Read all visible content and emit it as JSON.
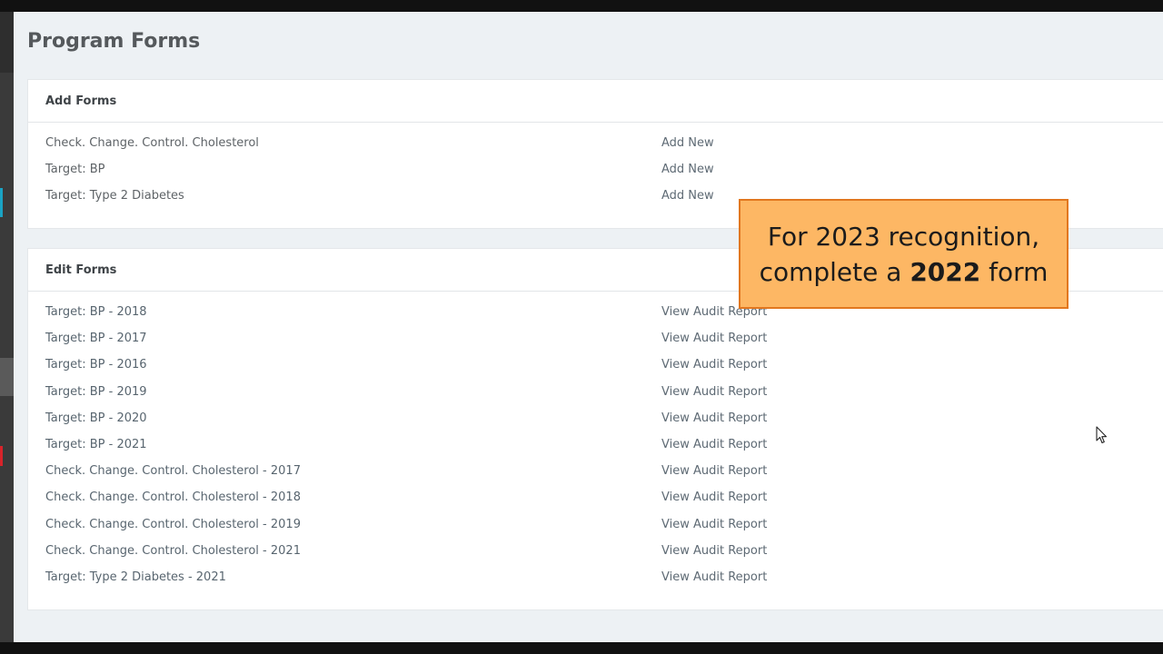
{
  "page": {
    "title": "Program Forms"
  },
  "add_forms": {
    "title": "Add Forms",
    "rows": [
      {
        "name": "Check. Change. Control. Cholesterol",
        "action": "Add New"
      },
      {
        "name": "Target: BP",
        "action": "Add New"
      },
      {
        "name": "Target: Type 2 Diabetes",
        "action": "Add New"
      }
    ]
  },
  "edit_forms": {
    "title": "Edit Forms",
    "rows": [
      {
        "name": "Target: BP - 2018",
        "action": "View Audit Report"
      },
      {
        "name": "Target: BP - 2017",
        "action": "View Audit Report"
      },
      {
        "name": "Target: BP - 2016",
        "action": "View Audit Report"
      },
      {
        "name": "Target: BP - 2019",
        "action": "View Audit Report"
      },
      {
        "name": "Target: BP - 2020",
        "action": "View Audit Report"
      },
      {
        "name": "Target: BP - 2021",
        "action": "View Audit Report"
      },
      {
        "name": "Check. Change. Control. Cholesterol - 2017",
        "action": "View Audit Report"
      },
      {
        "name": "Check. Change. Control. Cholesterol - 2018",
        "action": "View Audit Report"
      },
      {
        "name": "Check. Change. Control. Cholesterol - 2019",
        "action": "View Audit Report"
      },
      {
        "name": "Check. Change. Control. Cholesterol - 2021",
        "action": "View Audit Report"
      },
      {
        "name": "Target: Type 2 Diabetes - 2021",
        "action": "View Audit Report"
      }
    ]
  },
  "callout": {
    "line1": "For 2023 recognition,",
    "line2_prefix": "complete a ",
    "line2_bold": "2022",
    "line2_suffix": " form"
  },
  "colors": {
    "callout_fill": "#fdb764",
    "callout_border": "#e2771f",
    "rail_accent_teal": "#1aa3c4",
    "rail_accent_red": "#d8232a"
  }
}
